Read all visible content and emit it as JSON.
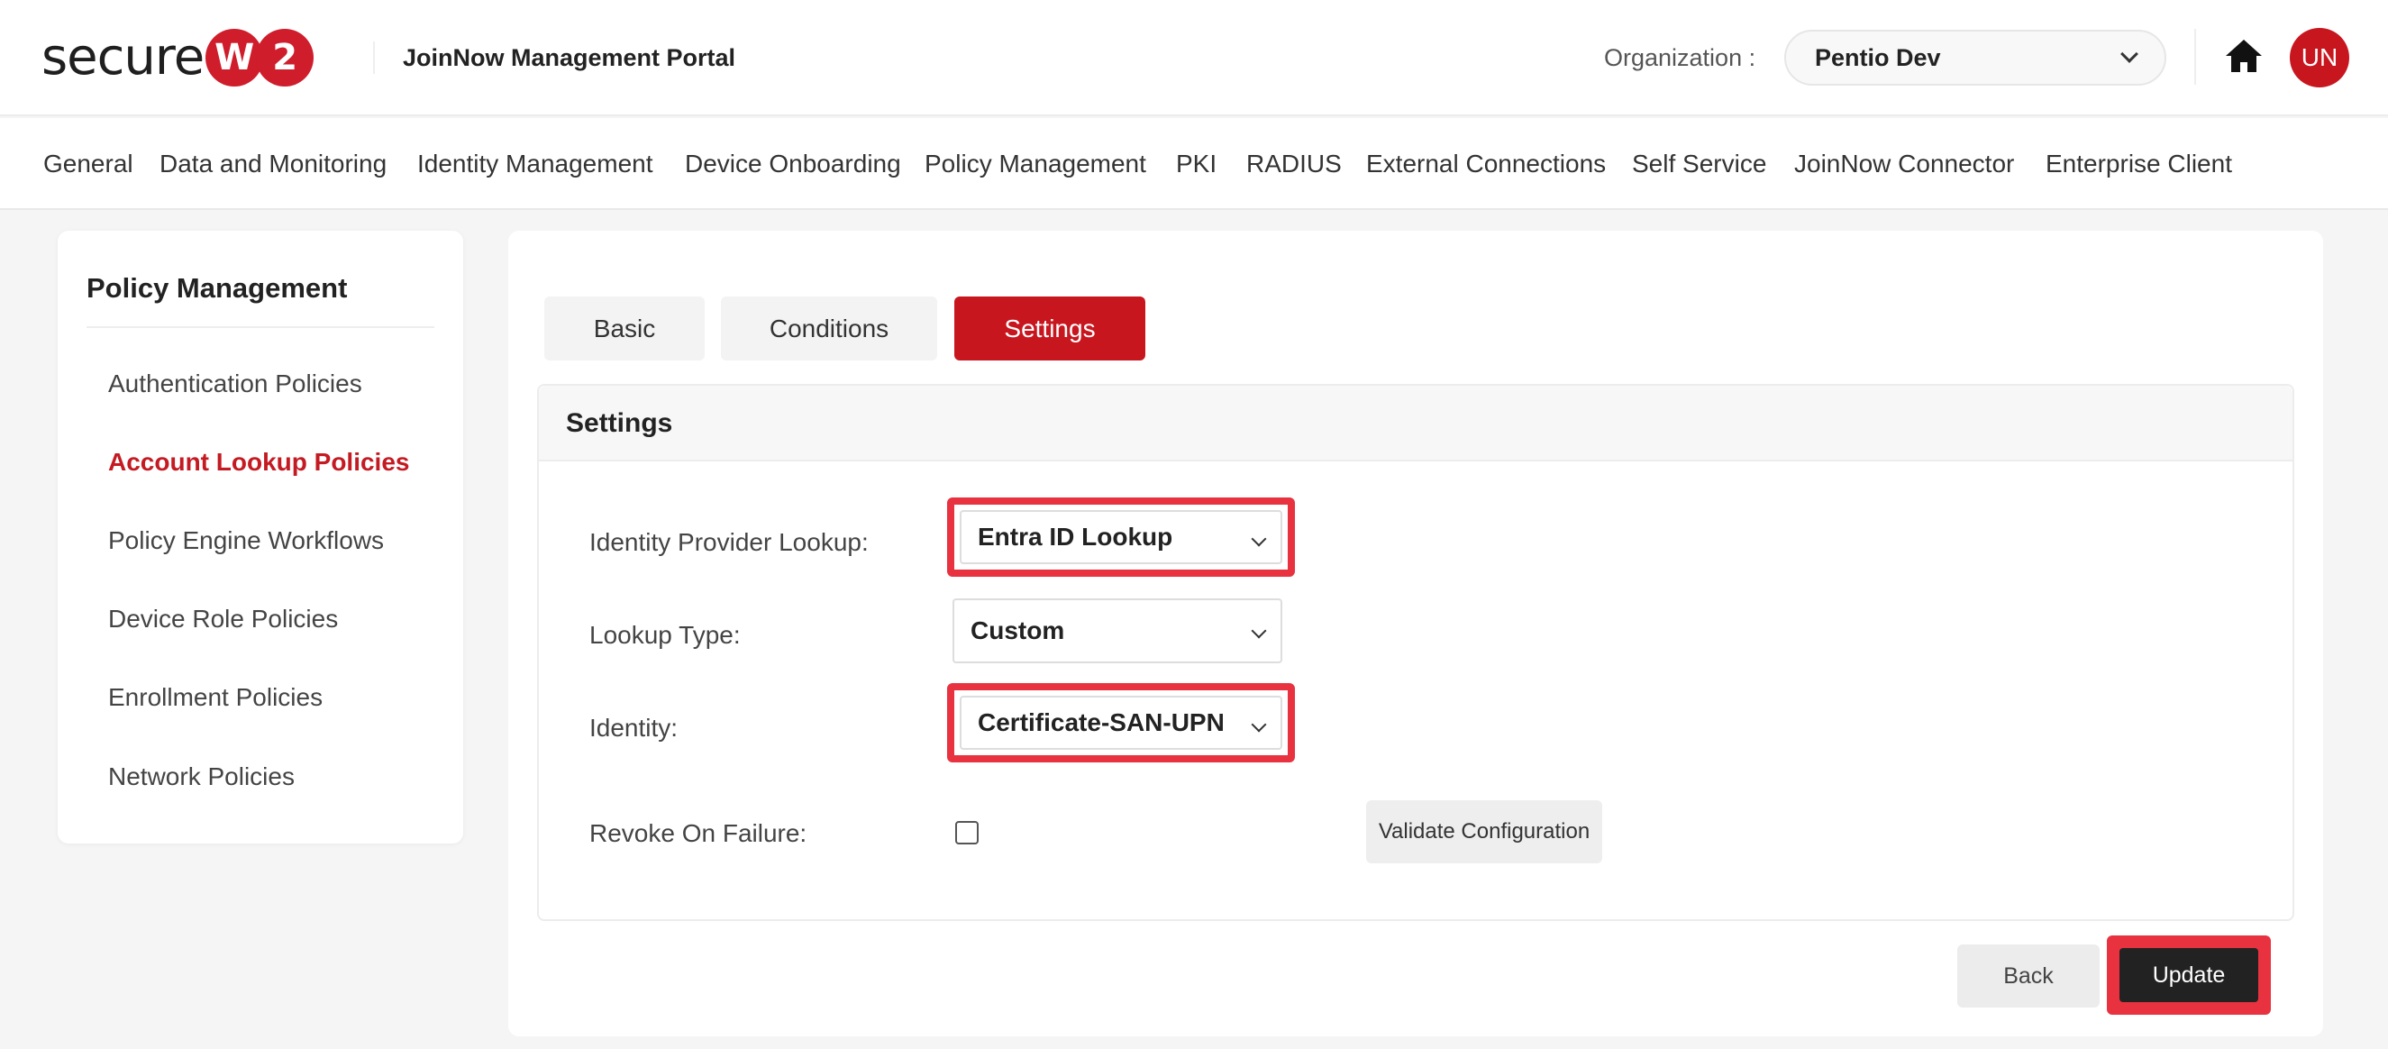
{
  "logo": {
    "text": "secure",
    "circle1": "W",
    "circle2": "2"
  },
  "header": {
    "portal_title": "JoinNow Management Portal",
    "org_label": "Organization :",
    "org_value": "Pentio Dev",
    "avatar_initials": "UN"
  },
  "nav": {
    "items": [
      "General",
      "Data and Monitoring",
      "Identity Management",
      "Device Onboarding",
      "Policy Management",
      "PKI",
      "RADIUS",
      "External Connections",
      "Self Service",
      "JoinNow Connector",
      "Enterprise Client"
    ]
  },
  "sidebar": {
    "title": "Policy Management",
    "items": [
      "Authentication Policies",
      "Account Lookup Policies",
      "Policy Engine Workflows",
      "Device Role Policies",
      "Enrollment Policies",
      "Network Policies"
    ],
    "active_item": "Account Lookup Policies"
  },
  "tabs": {
    "items": [
      "Basic",
      "Conditions",
      "Settings"
    ],
    "active": "Settings"
  },
  "settings": {
    "title": "Settings",
    "identity_provider_label": "Identity Provider Lookup:",
    "identity_provider_value": "Entra ID Lookup",
    "lookup_type_label": "Lookup Type:",
    "lookup_type_value": "Custom",
    "identity_label": "Identity:",
    "identity_value": "Certificate-SAN-UPN",
    "revoke_label": "Revoke On Failure:",
    "revoke_checked": false,
    "validate_label": "Validate Configuration"
  },
  "actions": {
    "back_label": "Back",
    "update_label": "Update"
  },
  "colors": {
    "brand_red": "#c8161f",
    "highlight_red": "#e8323f",
    "dark_button": "#222222"
  },
  "icons": [
    "chevron-down-icon",
    "home-icon"
  ]
}
